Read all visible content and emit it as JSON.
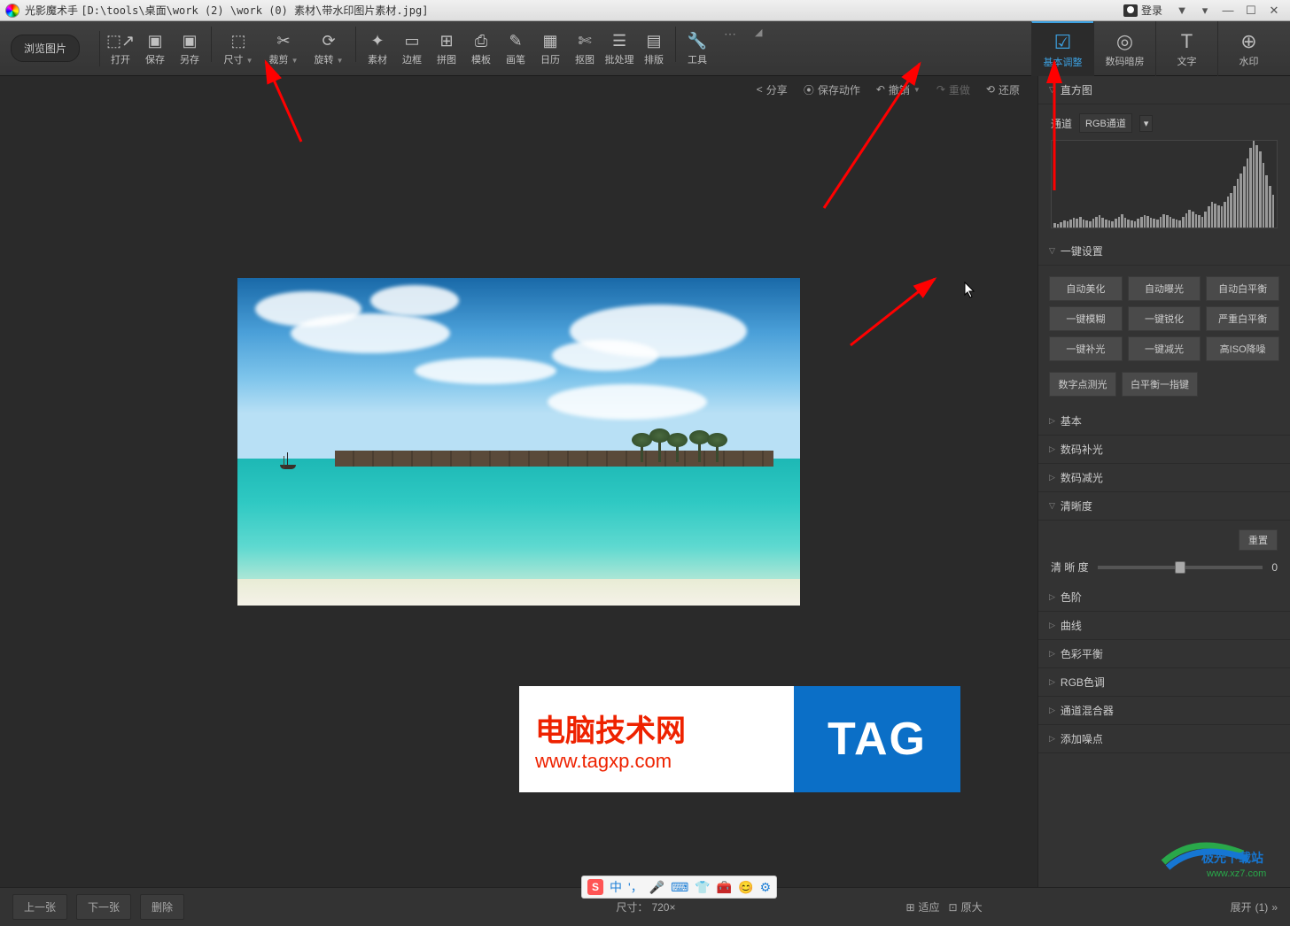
{
  "titlebar": {
    "app_name": "光影魔术手",
    "file_path": "[D:\\tools\\桌面\\work (2) \\work (0) 素材\\带水印图片素材.jpg]",
    "login_label": "登录"
  },
  "toolbar": {
    "browse": "浏览图片",
    "items": [
      {
        "label": "打开",
        "icon": "⬚↗"
      },
      {
        "label": "保存",
        "icon": "▣"
      },
      {
        "label": "另存",
        "icon": "▣"
      },
      {
        "label": "尺寸",
        "icon": "⬚"
      },
      {
        "label": "裁剪",
        "icon": "✂"
      },
      {
        "label": "旋转",
        "icon": "⟳"
      },
      {
        "label": "素材",
        "icon": "✦"
      },
      {
        "label": "边框",
        "icon": "▭"
      },
      {
        "label": "拼图",
        "icon": "⊞"
      },
      {
        "label": "模板",
        "icon": "⎙"
      },
      {
        "label": "画笔",
        "icon": "✎"
      },
      {
        "label": "日历",
        "icon": "▦"
      },
      {
        "label": "抠图",
        "icon": "✄"
      },
      {
        "label": "批处理",
        "icon": "☰"
      },
      {
        "label": "排版",
        "icon": "▤"
      },
      {
        "label": "工具",
        "icon": "🔧"
      }
    ]
  },
  "right_tabs": [
    {
      "label": "基本调整",
      "icon": "☑",
      "active": true
    },
    {
      "label": "数码暗房",
      "icon": "◎"
    },
    {
      "label": "文字",
      "icon": "T"
    },
    {
      "label": "水印",
      "icon": "⊕"
    }
  ],
  "actionbar": {
    "share": "分享",
    "save_action": "保存动作",
    "undo": "撤销",
    "redo": "重做",
    "restore": "还原"
  },
  "panel": {
    "histogram": "直方图",
    "channel_label": "通道",
    "channel_value": "RGB通道",
    "onekey": "一键设置",
    "auto_buttons": [
      "自动美化",
      "自动曝光",
      "自动白平衡",
      "一键模糊",
      "一键锐化",
      "严重白平衡",
      "一键补光",
      "一键减光",
      "高ISO降噪"
    ],
    "auto_row2": [
      "数字点测光",
      "白平衡一指键"
    ],
    "basic": "基本",
    "digital_fill": "数码补光",
    "digital_reduce": "数码减光",
    "clarity": "清晰度",
    "reset": "重置",
    "clarity_label": "清 晰 度",
    "clarity_value": "0",
    "levels": "色阶",
    "curves": "曲线",
    "color_balance": "色彩平衡",
    "rgb_tone": "RGB色调",
    "channel_mixer": "通道混合器",
    "add_noise": "添加噪点"
  },
  "bottom": {
    "prev": "上一张",
    "next": "下一张",
    "delete": "删除",
    "size_label": "尺寸：",
    "size_value": "720×",
    "fit": "适应",
    "orig": "原大",
    "expand": "展开",
    "expand_count": "(1)"
  },
  "watermark": {
    "cn": "电脑技术网",
    "url": "www.tagxp.com",
    "tag": "TAG"
  },
  "ime": {
    "s": "S",
    "zh": "中"
  },
  "corner": {
    "name": "极光下载站",
    "url": "www.xz7.com"
  },
  "histogram_bars": [
    5,
    4,
    6,
    8,
    7,
    9,
    11,
    10,
    12,
    9,
    8,
    7,
    10,
    12,
    14,
    11,
    9,
    8,
    7,
    10,
    12,
    15,
    11,
    9,
    8,
    7,
    10,
    12,
    14,
    13,
    11,
    10,
    9,
    12,
    15,
    14,
    12,
    10,
    9,
    8,
    12,
    16,
    20,
    18,
    15,
    14,
    12,
    18,
    24,
    30,
    28,
    26,
    25,
    30,
    36,
    40,
    48,
    56,
    62,
    70,
    80,
    92,
    100,
    95,
    88,
    75,
    60,
    48,
    38
  ]
}
